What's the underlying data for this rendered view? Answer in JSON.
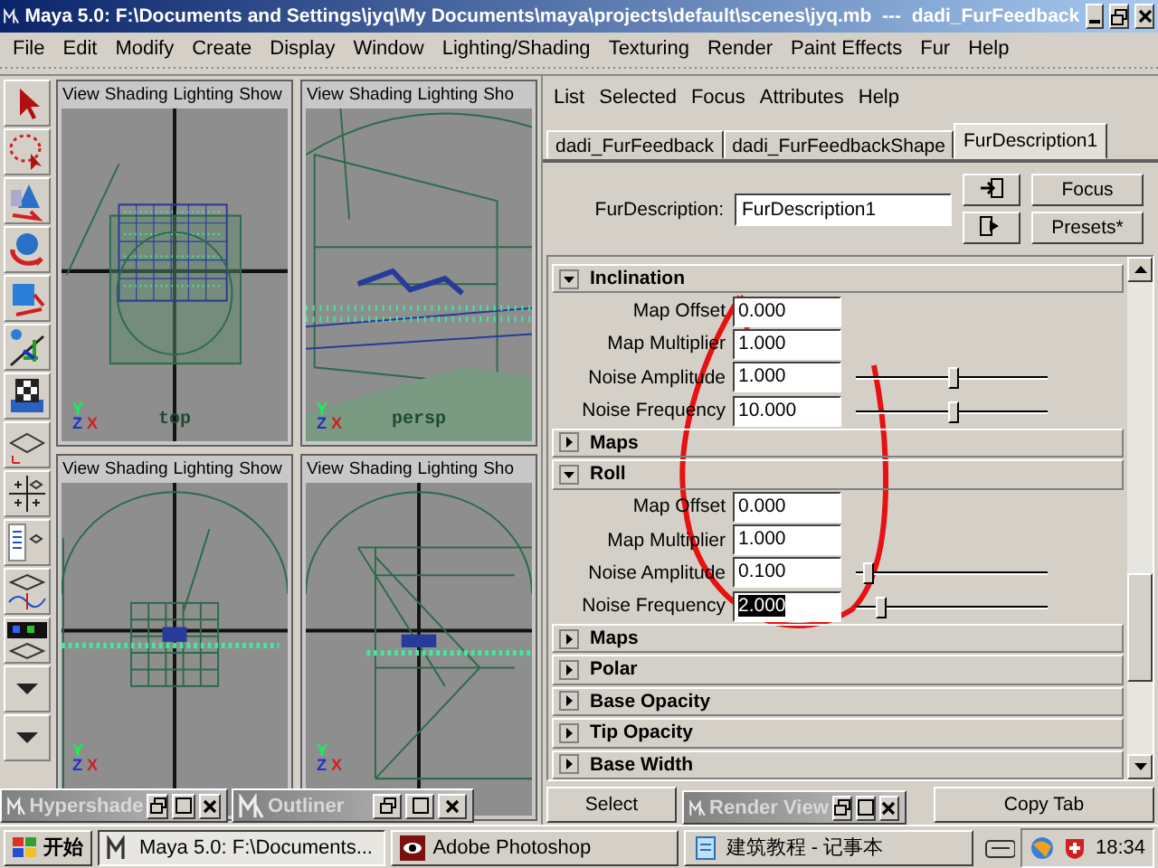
{
  "window": {
    "title": "Maya 5.0: F:\\Documents and Settings\\jyq\\My Documents\\maya\\projects\\default\\scenes\\jyq.mb  ---  dadi_FurFeedback"
  },
  "menu_bar": [
    "File",
    "Edit",
    "Modify",
    "Create",
    "Display",
    "Window",
    "Lighting/Shading",
    "Texturing",
    "Render",
    "Paint Effects",
    "Fur",
    "Help"
  ],
  "viewports": [
    {
      "menu": [
        "View",
        "Shading",
        "Lighting",
        "Show"
      ],
      "camera_label": "top",
      "axes": [
        "Y",
        "X",
        "Z"
      ]
    },
    {
      "menu": [
        "View",
        "Shading",
        "Lighting",
        "Sho"
      ],
      "camera_label": "persp",
      "axes": [
        "Y",
        "X",
        "Z"
      ]
    },
    {
      "menu": [
        "View",
        "Shading",
        "Lighting",
        "Show"
      ],
      "axes": [
        "Y",
        "X",
        "Z"
      ]
    },
    {
      "menu": [
        "View",
        "Shading",
        "Lighting",
        "Sho"
      ],
      "axes": [
        "Y",
        "X",
        "Z"
      ]
    }
  ],
  "attribute_editor": {
    "menu": [
      "List",
      "Selected",
      "Focus",
      "Attributes",
      "Help"
    ],
    "tabs": [
      {
        "label": "dadi_FurFeedback",
        "selected": false
      },
      {
        "label": "dadi_FurFeedbackShape",
        "selected": false
      },
      {
        "label": "FurDescription1",
        "selected": true
      }
    ],
    "node_label": "FurDescription:",
    "node_value": "FurDescription1",
    "buttons": [
      "Focus",
      "Presets*"
    ],
    "sections": [
      {
        "title": "Inclination",
        "expanded": true,
        "fields": [
          {
            "kind": "field",
            "label": "Map Offset",
            "value": "0.000",
            "selected": false
          },
          {
            "kind": "field",
            "label": "Map Multiplier",
            "value": "1.000",
            "selected": false
          },
          {
            "kind": "slider",
            "label": "Noise Amplitude",
            "value": "1.000",
            "level": 0.51,
            "selected": false
          },
          {
            "kind": "slider",
            "label": "Noise Frequency",
            "value": "10.000",
            "level": 0.51,
            "selected": false
          }
        ]
      },
      {
        "title": "Maps",
        "expanded": false
      },
      {
        "title": "Roll",
        "expanded": true,
        "fields": [
          {
            "kind": "field",
            "label": "Map Offset",
            "value": "0.000",
            "selected": false
          },
          {
            "kind": "field",
            "label": "Map Multiplier",
            "value": "1.000",
            "selected": false
          },
          {
            "kind": "slider",
            "label": "Noise Amplitude",
            "value": "0.100",
            "level": 0.07,
            "selected": false
          },
          {
            "kind": "slider",
            "label": "Noise Frequency",
            "value": "2.000",
            "level": 0.13,
            "selected": true
          }
        ]
      },
      {
        "title": "Maps",
        "expanded": false
      },
      {
        "title": "Polar",
        "expanded": false
      },
      {
        "title": "Base Opacity",
        "expanded": false
      },
      {
        "title": "Tip Opacity",
        "expanded": false
      },
      {
        "title": "Base Width",
        "expanded": false
      }
    ],
    "bottom_buttons": [
      "Select",
      "Copy Tab"
    ]
  },
  "floating_windows": [
    {
      "title": "Hypershade",
      "active": false
    },
    {
      "title": "Outliner",
      "active": false
    },
    {
      "title": "Render View",
      "active": false
    }
  ],
  "taskbar": {
    "start": "开始",
    "tasks": [
      {
        "label": "Maya 5.0: F:\\Documents...",
        "selected": true
      },
      {
        "label": "Adobe Photoshop",
        "selected": false
      },
      {
        "label": "建筑教程 - 记事本",
        "selected": false
      }
    ],
    "clock": "18:34"
  }
}
